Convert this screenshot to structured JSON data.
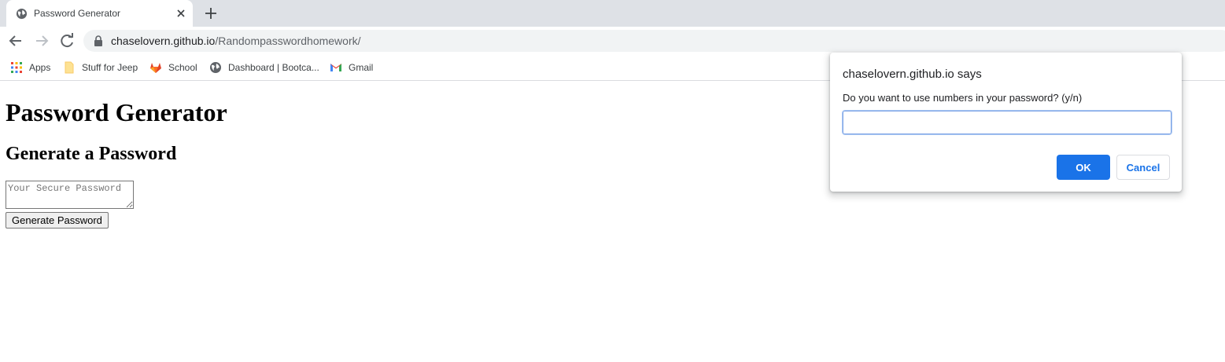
{
  "tab": {
    "title": "Password Generator",
    "favicon_icon": "globe-icon",
    "close_icon": "close-icon",
    "new_tab_icon": "plus-icon"
  },
  "toolbar": {
    "back_icon": "arrow-left-icon",
    "forward_icon": "arrow-right-icon",
    "reload_icon": "reload-icon",
    "lock_icon": "lock-icon",
    "url_host": "chaselovern.github.io",
    "url_path": "/Randompasswordhomework/"
  },
  "bookmarks": {
    "items": [
      {
        "label": "Apps",
        "icon": "apps-grid-icon"
      },
      {
        "label": "Stuff for Jeep",
        "icon": "folder-icon"
      },
      {
        "label": "School",
        "icon": "gitlab-icon"
      },
      {
        "label": "Dashboard | Bootca...",
        "icon": "globe-icon"
      },
      {
        "label": "Gmail",
        "icon": "gmail-icon"
      }
    ]
  },
  "page": {
    "heading": "Password Generator",
    "subheading": "Generate a Password",
    "password_placeholder": "Your Secure Password",
    "password_value": "",
    "generate_button_label": "Generate Password"
  },
  "dialog": {
    "title": "chaselovern.github.io says",
    "message": "Do you want to use numbers in your password? (y/n)",
    "input_value": "",
    "ok_label": "OK",
    "cancel_label": "Cancel"
  },
  "colors": {
    "tabstrip_bg": "#dee1e6",
    "omnibox_bg": "#f1f3f4",
    "primary_blue": "#1a73e8"
  }
}
